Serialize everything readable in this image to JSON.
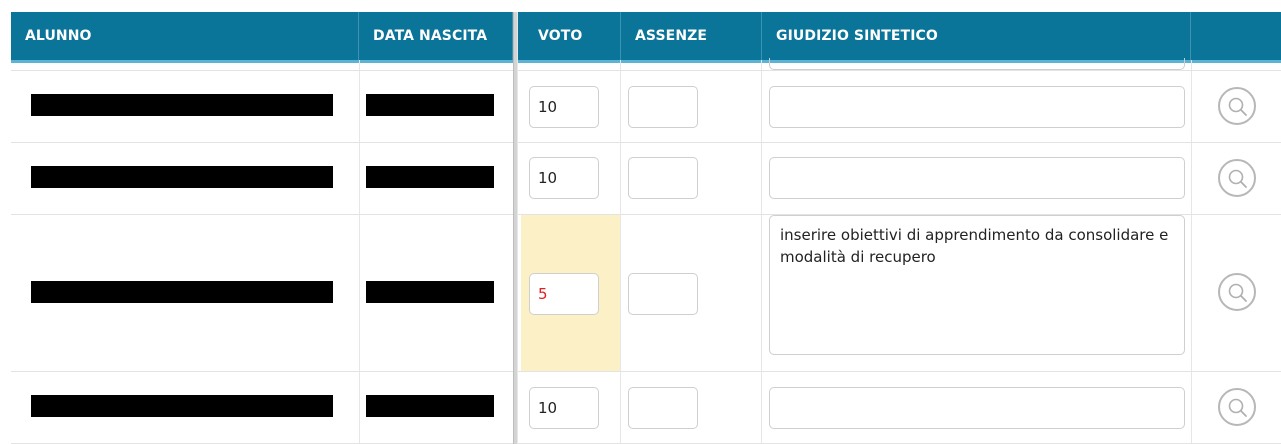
{
  "header": {
    "columns": [
      "ALUNNO",
      "DATA NASCITA",
      "VOTO",
      "ASSENZE",
      "GIUDIZIO SINTETICO",
      ""
    ]
  },
  "rows": [
    {
      "voto": "10",
      "assenze": "",
      "giudizio": ""
    },
    {
      "voto": "10",
      "assenze": "",
      "giudizio": ""
    },
    {
      "voto": "5",
      "assenze": "",
      "giudizio": "inserire obiettivi di apprendimento da consolidare e modalità di recupero"
    },
    {
      "voto": "10",
      "assenze": "",
      "giudizio": ""
    }
  ],
  "colors": {
    "header_bg": "#0b7499",
    "insufficient_highlight": "#fcf1c6",
    "insufficient_text": "#e02020"
  },
  "icons": {
    "details": "magnifier-icon"
  }
}
